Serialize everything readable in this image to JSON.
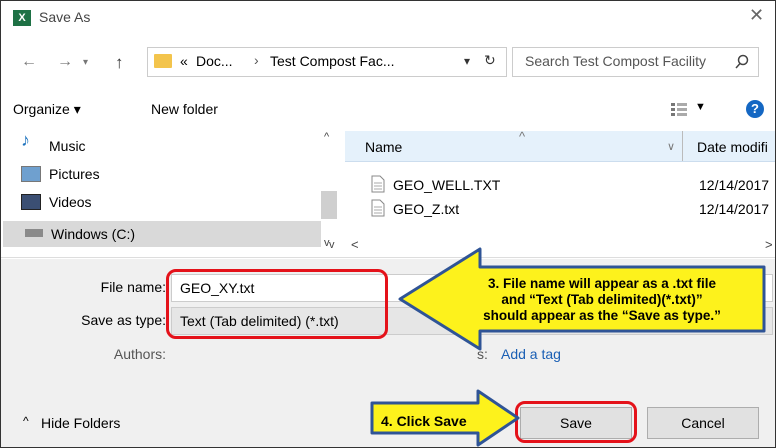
{
  "window": {
    "title": "Save As",
    "app_icon": "excel-icon",
    "icon_text": "X"
  },
  "nav": {
    "path_prefix": "«",
    "path_segments": [
      "Doc...",
      "Test Compost Fac..."
    ],
    "separator": "›",
    "search_placeholder": "Search Test Compost Facility"
  },
  "toolbar": {
    "organize_label": "Organize ▾",
    "new_folder_label": "New folder"
  },
  "sidebar": {
    "items": [
      {
        "label": "Music",
        "icon": "music-icon"
      },
      {
        "label": "Pictures",
        "icon": "pictures-icon"
      },
      {
        "label": "Videos",
        "icon": "videos-icon"
      },
      {
        "label": "Windows (C:)",
        "icon": "drive-icon"
      }
    ]
  },
  "columns": {
    "name": "Name",
    "date": "Date modifi"
  },
  "files": [
    {
      "name": "GEO_WELL.TXT",
      "date": "12/14/2017"
    },
    {
      "name": "GEO_Z.txt",
      "date": "12/14/2017"
    }
  ],
  "form": {
    "file_name_label": "File name:",
    "file_name_value": "GEO_XY.txt",
    "save_type_label": "Save as type:",
    "save_type_value": "Text (Tab delimited) (*.txt)",
    "authors_label": "Authors:",
    "tags_label_visible": "s:",
    "tags_value": "Add a tag"
  },
  "footer": {
    "hide_folders": "Hide Folders",
    "save_label": "Save",
    "cancel_label": "Cancel"
  },
  "annotations": {
    "callout3": [
      "3.  File name will appear as a .txt file",
      "and “Text (Tab delimited)(*.txt)”",
      "should appear as the “Save as type.”"
    ],
    "callout4": "4.  Click Save"
  },
  "colors": {
    "callout_fill": "#fdf21c",
    "callout_stroke": "#2f5496",
    "highlight": "#e4121a",
    "selected_item": "#cce8ff"
  }
}
